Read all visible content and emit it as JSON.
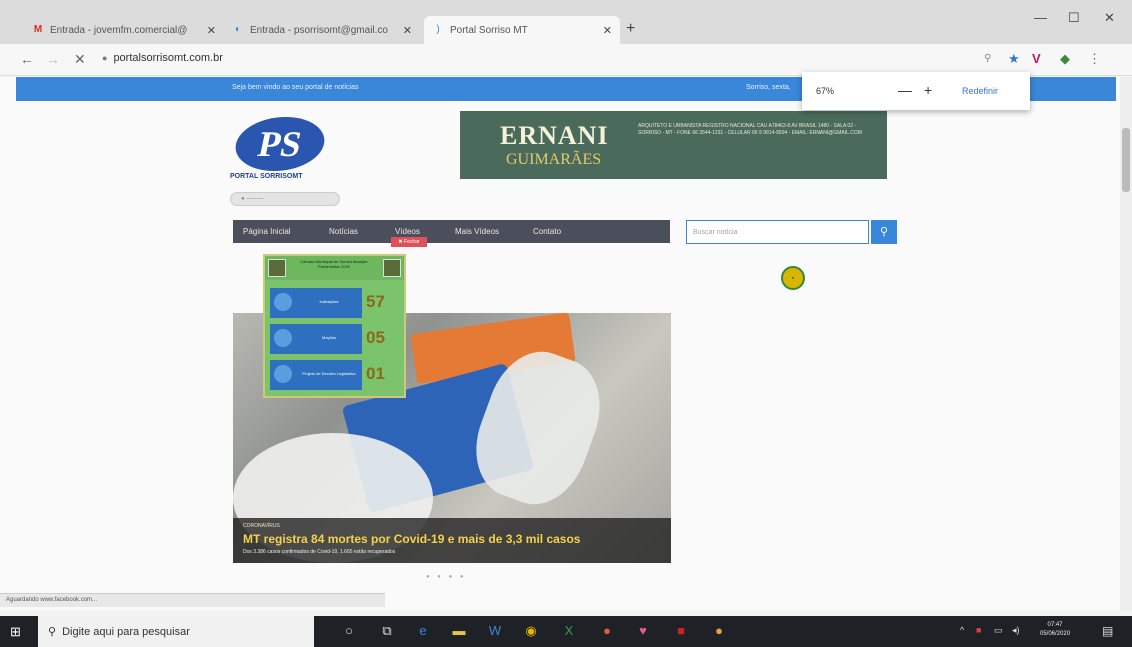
{
  "browser": {
    "tabs": [
      {
        "label": "Entrada - jovemfm.comercial@",
        "icon": "gmail-icon"
      },
      {
        "label": "Entrada - psorrisomt@gmail.co",
        "icon": "chrome-icon"
      },
      {
        "label": "Portal Sorriso MT",
        "icon": "loading-icon"
      }
    ],
    "url": "portalsorrisomt.com.br",
    "zoom": {
      "value": "67%",
      "minus": "—",
      "plus": "+",
      "reset": "Redefinir"
    }
  },
  "site": {
    "topbar_left": "Seja bem vindo ao seu portal de notícias",
    "topbar_right": "Sorriso, sexta,",
    "logo_text": "PS",
    "logo_name": "PORTAL SORRISOMT",
    "ad": {
      "line1": "ERNANI",
      "line2": "GUIMARÃES",
      "details": "ARQUITETO E URBANISTA REGISTRO NACIONAL CAU A78463-8 AV BRASIL 1480 - SALA 02 - SORRISO - MT - FONE 66 3544-1231 - CELULAR 66 9 9914-9504 - EMAIL: ERNANI@GMAIL.COM"
    },
    "nav": [
      "Página Inicial",
      "Notícias",
      "Vídeos",
      "Mais Vídeos",
      "Contato"
    ],
    "fechar": "Fechar",
    "search_placeholder": "Buscar notícia",
    "widget": {
      "title": "Câmara Municipal de Sorriso Atuação Parlamentar 2020",
      "rows": [
        {
          "label": "Indicações",
          "value": "57"
        },
        {
          "label": "Moções",
          "value": "05"
        },
        {
          "label": "Projeto de Decreto Legislativo",
          "value": "01"
        }
      ]
    },
    "feature": {
      "category": "CORONAVÍRUS",
      "headline": "MT registra 84 mortes por Covid-19 e mais de 3,3 mil casos",
      "sub": "Dos 3.386 casos confirmados de Covid-19, 1.665 estão recuperados"
    }
  },
  "status_text": "Aguardando www.facebook.com...",
  "taskbar": {
    "search_placeholder": "Digite aqui para pesquisar",
    "time": "07:47",
    "date": "05/06/2020"
  }
}
